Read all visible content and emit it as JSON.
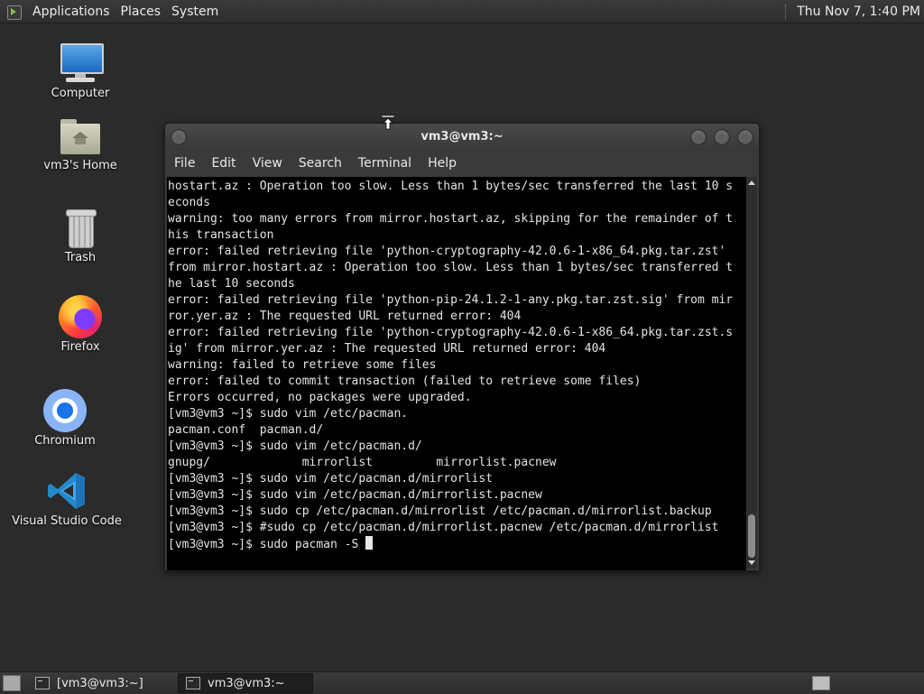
{
  "top_panel": {
    "menus": [
      "Applications",
      "Places",
      "System"
    ],
    "clock": "Thu Nov 7, 1:40 PM"
  },
  "desktop_icons": [
    {
      "label": "Computer",
      "icon": "computer-icon"
    },
    {
      "label": "vm3's Home",
      "icon": "home-folder-icon"
    },
    {
      "label": "Trash",
      "icon": "trash-icon"
    },
    {
      "label": "Firefox",
      "icon": "firefox-icon"
    },
    {
      "label": "Chromium",
      "icon": "chromium-icon"
    },
    {
      "label": "Visual Studio Code",
      "icon": "vscode-icon"
    }
  ],
  "terminal": {
    "title": "vm3@vm3:~",
    "menu": [
      "File",
      "Edit",
      "View",
      "Search",
      "Terminal",
      "Help"
    ],
    "lines": [
      "hostart.az : Operation too slow. Less than 1 bytes/sec transferred the last 10 s",
      "econds",
      "warning: too many errors from mirror.hostart.az, skipping for the remainder of t",
      "his transaction",
      "error: failed retrieving file 'python-cryptography-42.0.6-1-x86_64.pkg.tar.zst'",
      "from mirror.hostart.az : Operation too slow. Less than 1 bytes/sec transferred t",
      "he last 10 seconds",
      "error: failed retrieving file 'python-pip-24.1.2-1-any.pkg.tar.zst.sig' from mir",
      "ror.yer.az : The requested URL returned error: 404",
      "error: failed retrieving file 'python-cryptography-42.0.6-1-x86_64.pkg.tar.zst.s",
      "ig' from mirror.yer.az : The requested URL returned error: 404",
      "warning: failed to retrieve some files",
      "error: failed to commit transaction (failed to retrieve some files)",
      "Errors occurred, no packages were upgraded.",
      "[vm3@vm3 ~]$ sudo vim /etc/pacman.",
      "pacman.conf  pacman.d/",
      "[vm3@vm3 ~]$ sudo vim /etc/pacman.d/",
      "gnupg/             mirrorlist         mirrorlist.pacnew",
      "[vm3@vm3 ~]$ sudo vim /etc/pacman.d/mirrorlist",
      "[vm3@vm3 ~]$ sudo vim /etc/pacman.d/mirrorlist.pacnew",
      "[vm3@vm3 ~]$ sudo cp /etc/pacman.d/mirrorlist /etc/pacman.d/mirrorlist.backup",
      "[vm3@vm3 ~]$ #sudo cp /etc/pacman.d/mirrorlist.pacnew /etc/pacman.d/mirrorlist"
    ],
    "prompt_line": "[vm3@vm3 ~]$ sudo pacman -S "
  },
  "taskbar": {
    "tasks": [
      {
        "label": "[vm3@vm3:~]",
        "active": false
      },
      {
        "label": "vm3@vm3:~",
        "active": true
      }
    ]
  }
}
